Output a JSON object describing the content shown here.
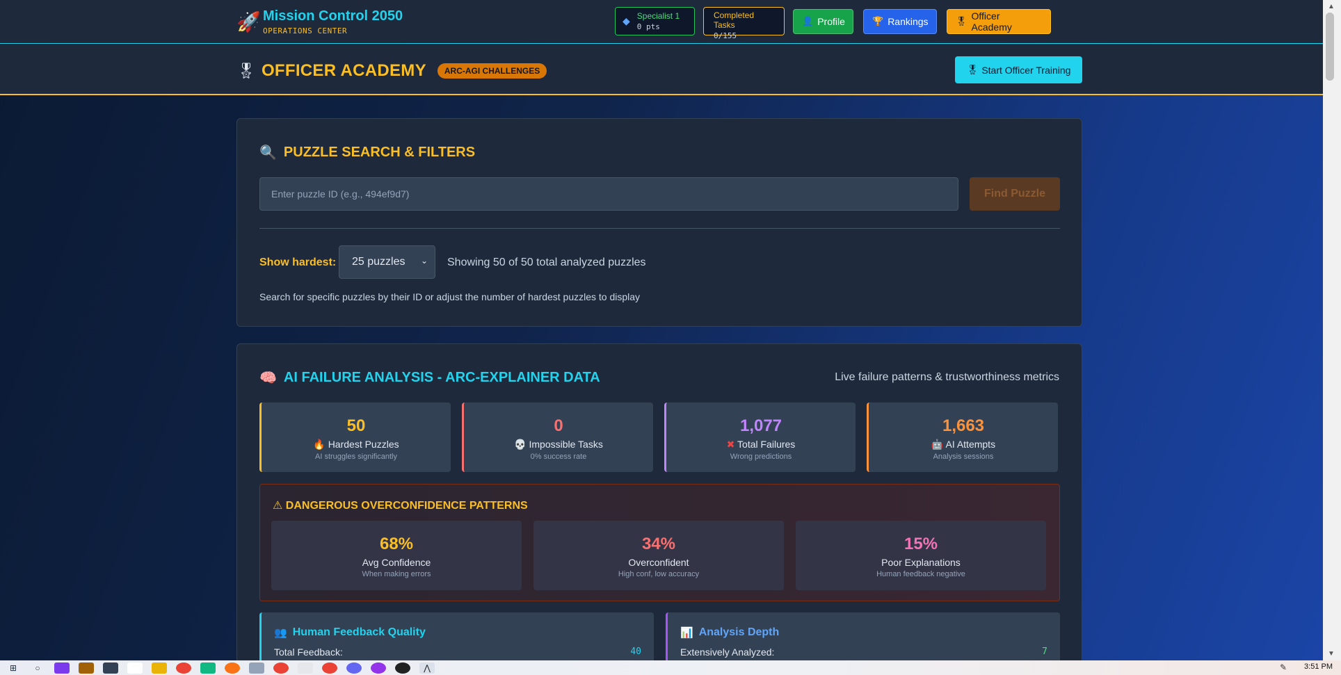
{
  "nav": {
    "brand_title": "Mission Control 2050",
    "brand_subtitle": "OPERATIONS CENTER",
    "specialist_name": "Specialist 1",
    "specialist_points": "0 pts",
    "tasks_label": "Completed Tasks",
    "tasks_value": "0/155",
    "profile_label": "Profile",
    "rankings_label": "Rankings",
    "academy_label": "Officer Academy"
  },
  "academy": {
    "title": "OFFICER ACADEMY",
    "badge": "ARC-AGI CHALLENGES",
    "start_button": "Start Officer Training"
  },
  "search": {
    "title": "PUZZLE SEARCH & FILTERS",
    "placeholder": "Enter puzzle ID (e.g., 494ef9d7)",
    "find_button": "Find Puzzle",
    "show_label": "Show hardest:",
    "selected_option": "25 puzzles",
    "showing_text": "Showing 50 of 50 total analyzed puzzles",
    "hint": "Search for specific puzzles by their ID or adjust the number of hardest puzzles to display"
  },
  "analysis": {
    "title": "AI FAILURE ANALYSIS - ARC-EXPLAINER DATA",
    "live_text": "Live failure patterns & trustworthiness metrics",
    "stats": [
      {
        "value": "50",
        "label": "Hardest Puzzles",
        "sub": "AI struggles significantly",
        "icon": "flame-icon",
        "color": "#fbbf24"
      },
      {
        "value": "0",
        "label": "Impossible Tasks",
        "sub": "0% success rate",
        "icon": "skull-icon",
        "color": "#f87171"
      },
      {
        "value": "1,077",
        "label": "Total Failures",
        "sub": "Wrong predictions",
        "icon": "cross-icon",
        "color": "#c084fc"
      },
      {
        "value": "1,663",
        "label": "AI Attempts",
        "sub": "Analysis sessions",
        "icon": "robot-icon",
        "color": "#fb923c"
      }
    ],
    "danger": {
      "title": "DANGEROUS OVERCONFIDENCE PATTERNS",
      "stats": [
        {
          "value": "68%",
          "label": "Avg Confidence",
          "sub": "When making errors",
          "color": "#fbbf24"
        },
        {
          "value": "34%",
          "label": "Overconfident",
          "sub": "High conf, low accuracy",
          "color": "#f87171"
        },
        {
          "value": "15%",
          "label": "Poor Explanations",
          "sub": "Human feedback negative",
          "color": "#f472b6"
        }
      ]
    },
    "feedback": {
      "title": "Human Feedback Quality",
      "row_label": "Total Feedback:",
      "row_value": "40"
    },
    "depth": {
      "title": "Analysis Depth",
      "row_label": "Extensively Analyzed:",
      "row_value": "7"
    }
  },
  "taskbar": {
    "time": "3:51 PM"
  },
  "colors": {
    "accent_cyan": "#22d3ee",
    "accent_amber": "#fbbf24",
    "panel": "#1e293b"
  }
}
